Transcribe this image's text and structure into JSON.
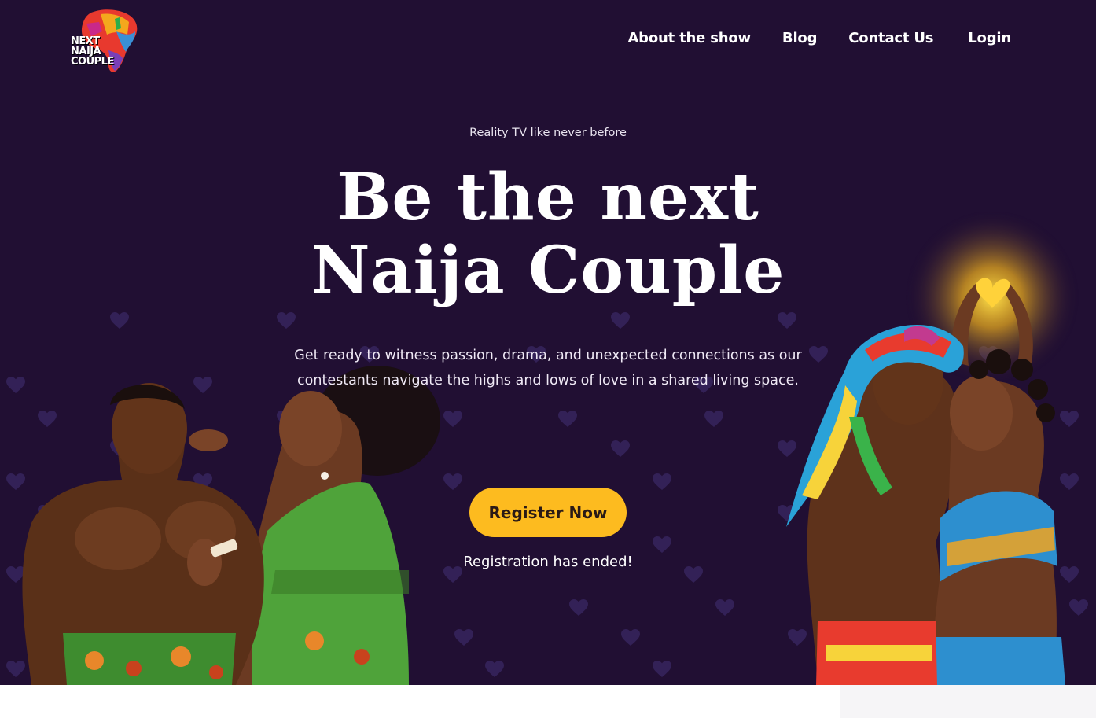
{
  "header": {
    "logo_text": "NEXT NAIJA COUPLE",
    "nav": [
      {
        "label": "About the show"
      },
      {
        "label": "Blog"
      },
      {
        "label": "Contact Us"
      },
      {
        "label": "Login"
      }
    ]
  },
  "hero": {
    "tagline": "Reality TV like never before",
    "headline_line1": "Be the next",
    "headline_line2": "Naija Couple",
    "description": "Get ready to witness passion, drama, and unexpected connections as our contestants navigate the highs and lows of love in a shared living space.",
    "cta_label": "Register Now",
    "status": "Registration has ended!"
  },
  "colors": {
    "background": "#210f33",
    "accent": "#fdbb1f",
    "heart": "#3a2862"
  }
}
